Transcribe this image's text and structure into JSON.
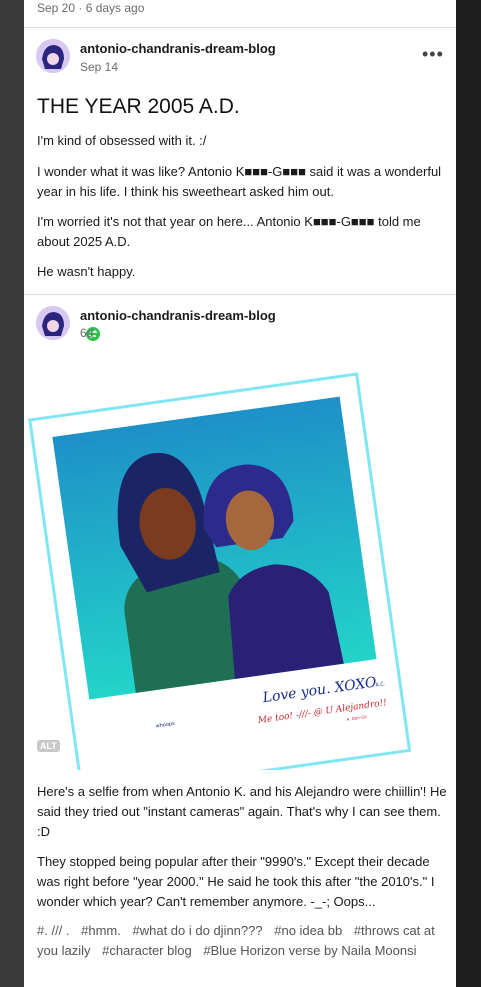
{
  "prev_post": {
    "meta": "Sep 20 · 6 days ago"
  },
  "post1": {
    "blog_name": "antonio-chandranis-dream-blog",
    "date": "Sep 14",
    "menu_icon": "more-horizontal-icon",
    "title": "THE YEAR 2005 A.D.",
    "paragraphs": [
      "I'm kind of obsessed with it. :/",
      "I wonder what it was like? Antonio K■■■-G■■■ said it was a wonderful year in his life. I think his sweetheart asked him out.",
      "I'm worried it's not that year on here... Antonio K■■■-G■■■ told me about 2025 A.D.",
      "He wasn't happy."
    ]
  },
  "post2": {
    "blog_name": "antonio-chandranis-dream-blog",
    "date": "6d",
    "reblog_icon": "reblog-icon",
    "image": {
      "alt_badge": "ALT",
      "caption_main": "Love you. XOXO",
      "caption_sig": "- A.C.",
      "caption_reply": "Me too! -///- @ U Alejandro!!",
      "caption_reply_sig": "A. Dan-Gil",
      "caption_whoops": "whoops",
      "colors": {
        "sky": "#1aa7b8",
        "frame_glow": "#7fe6f2"
      }
    },
    "paragraphs": [
      "Here's a selfie from when Antonio K. and his Alejandro were chiillin'! He said they tried out \"instant cameras\" again. That's why I can see them. :D",
      "They stopped being popular after their \"9990's.\" Except their decade was right before \"year 2000.\" He said he took this after \"the 2010's.\" I wonder which year? Can't remember anymore. -_-; Oops..."
    ],
    "tags": [
      "#. /// .",
      "#hmm.",
      "#what do i do djinn???",
      "#no idea bb",
      "#throws cat at you lazily",
      "#character blog",
      "#Blue Horizon verse by Naila Moonsi"
    ]
  }
}
